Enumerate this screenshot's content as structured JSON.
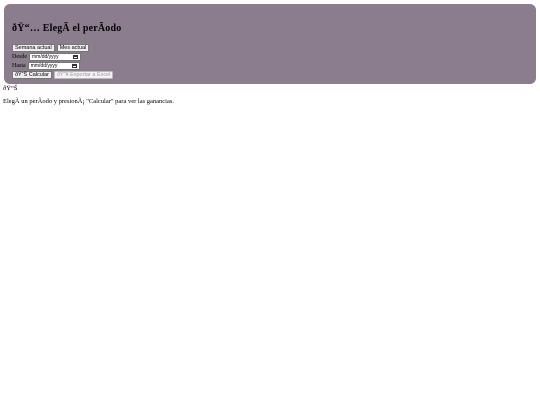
{
  "panel": {
    "title": "ðŸ“… ElegÃ­ el perÃ­odo",
    "quick_buttons": [
      "Semana actual",
      "Mes actual"
    ],
    "from_label": "Desde",
    "to_label": "Hasta",
    "date_placeholder": "mm/dd/yyyy",
    "calculate_label": "ðŸ“Š Calcular",
    "export_label": "ðŸ“¥ Exportar a Excel"
  },
  "results": {
    "icon_line": "ðŸ“Š",
    "message": "ElegÃ­ un perÃ­odo y presionÃ¡ \"Calcular\" para ver las ganancias."
  },
  "colors": {
    "panel_bg": "#8b7d8e"
  }
}
